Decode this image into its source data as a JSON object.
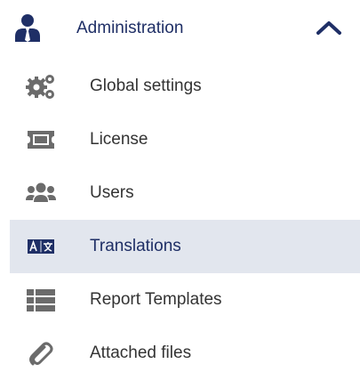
{
  "header": {
    "label": "Administration",
    "icon": "user-tie-icon",
    "toggle_icon": "chevron-up-icon"
  },
  "items": [
    {
      "label": "Global settings",
      "icon": "cogs-icon",
      "active": false
    },
    {
      "label": "License",
      "icon": "ticket-icon",
      "active": false
    },
    {
      "label": "Users",
      "icon": "users-icon",
      "active": false
    },
    {
      "label": "Translations",
      "icon": "language-icon",
      "active": true
    },
    {
      "label": "Report Templates",
      "icon": "th-list-icon",
      "active": false
    },
    {
      "label": "Attached files",
      "icon": "paperclip-icon",
      "active": false
    }
  ],
  "colors": {
    "accent": "#1f2f66",
    "text": "#333333",
    "icon": "#6b6b6b",
    "active_bg": "#e2e6ee"
  }
}
